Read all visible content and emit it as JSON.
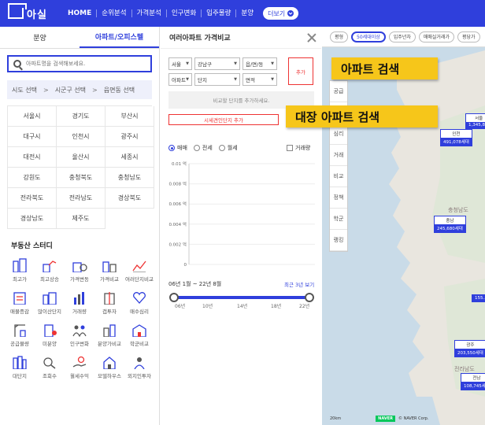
{
  "header": {
    "logo_text": "아실",
    "nav": [
      "HOME",
      "순위분석",
      "가격분석",
      "인구변화",
      "입주물량",
      "분양"
    ],
    "more_label": "더보기"
  },
  "left_panel": {
    "tabs": [
      {
        "label": "분양",
        "active": false
      },
      {
        "label": "아파트/오피스텔",
        "active": true
      }
    ],
    "search_placeholder": "아파트명을 검색해보세요.",
    "region_steps": [
      "시도 선택",
      ">",
      "시군구 선택",
      ">",
      "읍면동 선택"
    ],
    "cities": [
      "서울시",
      "경기도",
      "부산시",
      "대구시",
      "인천시",
      "광주시",
      "대전시",
      "울산시",
      "세종시",
      "강원도",
      "충청북도",
      "충청남도",
      "전라북도",
      "전라남도",
      "경상북도",
      "경상남도",
      "제주도"
    ],
    "study_title": "부동산 스터디",
    "study_items": [
      "최고가",
      "최고상승",
      "가격변동",
      "가격비교",
      "여러단지비교",
      "매물증감",
      "많이산단지",
      "거래량",
      "갭투자",
      "매수심리",
      "공급물량",
      "미분양",
      "인구변화",
      "분양가비교",
      "학군비교",
      "대단지",
      "조회수",
      "월세수익",
      "모델하우스",
      "외지인투자"
    ]
  },
  "compare_panel": {
    "title": "여러아파트 가격비교",
    "row1": [
      "서울",
      "강남구",
      "읍/면/동"
    ],
    "row2": [
      "아파트",
      "단지",
      "면적"
    ],
    "add_label": "추가",
    "empty_text": "비교할 단지를 추가하세요.",
    "big_complex_button": "시세견인단지 추가",
    "radios": [
      {
        "label": "매매",
        "on": true
      },
      {
        "label": "전세",
        "on": false
      },
      {
        "label": "월세",
        "on": false
      }
    ],
    "volume_label": "거래량",
    "period_text": "06년 1월 ~ 22년 8월",
    "recent_label": "최근 3년 보기",
    "slider_ticks": [
      "06년",
      "10년",
      "14년",
      "18년",
      "22년"
    ],
    "slider_range": [
      0,
      1
    ]
  },
  "chart_data": {
    "type": "line",
    "title": "",
    "xlabel": "",
    "ylabel": "",
    "ylim": [
      0,
      0.01
    ],
    "yticks": [
      "0.01 억",
      "0.008 억",
      "0.006 억",
      "0.004 억",
      "0.002 억",
      "0"
    ],
    "series": []
  },
  "map": {
    "chips": [
      {
        "label": "평형",
        "on": false
      },
      {
        "label": "50세대이상",
        "on": true
      },
      {
        "label": "입주년차",
        "on": false
      },
      {
        "label": "매매실거래가",
        "on": false
      },
      {
        "label": "평당가",
        "on": false
      }
    ],
    "side_menu": [
      "공급",
      "가격",
      "심리",
      "거래",
      "비교",
      "정책",
      "학군",
      "랭킹"
    ],
    "markers": [
      {
        "name": "인천",
        "value": "491,078세대"
      },
      {
        "name": "서울",
        "value": "1,345,8..."
      },
      {
        "name": "충남",
        "value": "245,680세대"
      },
      {
        "name": "광주",
        "value": "203,550세대"
      },
      {
        "name": "전남",
        "value": "108,745세대"
      },
      {
        "name": "",
        "value": "155..."
      }
    ],
    "place_labels": [
      "충청남도",
      "전라남도"
    ],
    "scale_text": "20km",
    "naver_text": "NAVER",
    "copyright": "© NAVER Corp."
  },
  "callouts": [
    "아파트 검색",
    "대장 아파트 검색"
  ],
  "colors": {
    "brand": "#2f3fdc",
    "accent_red": "#e33333",
    "callout": "#f6c61a"
  }
}
